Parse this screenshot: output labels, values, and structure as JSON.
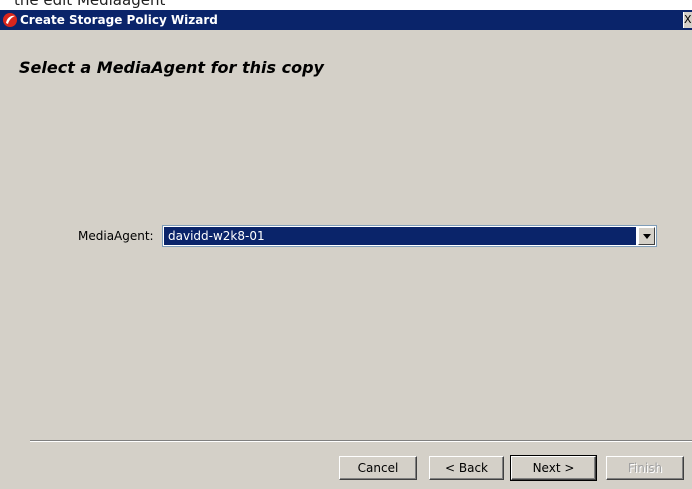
{
  "background_text": "the edit Mediaagent",
  "window": {
    "title": "Create Storage Policy Wizard",
    "close_label": "X"
  },
  "page": {
    "heading": "Select a MediaAgent for this copy"
  },
  "form": {
    "mediaagent_label": "MediaAgent:",
    "mediaagent_value": "davidd-w2k8-01"
  },
  "buttons": {
    "cancel": "Cancel",
    "back": "< Back",
    "next": "Next >",
    "finish": "Finish"
  },
  "colors": {
    "titlebar": "#0a246a",
    "dialog_bg": "#d4d0c8",
    "selection": "#0a246a",
    "icon_red": "#d9261c"
  }
}
